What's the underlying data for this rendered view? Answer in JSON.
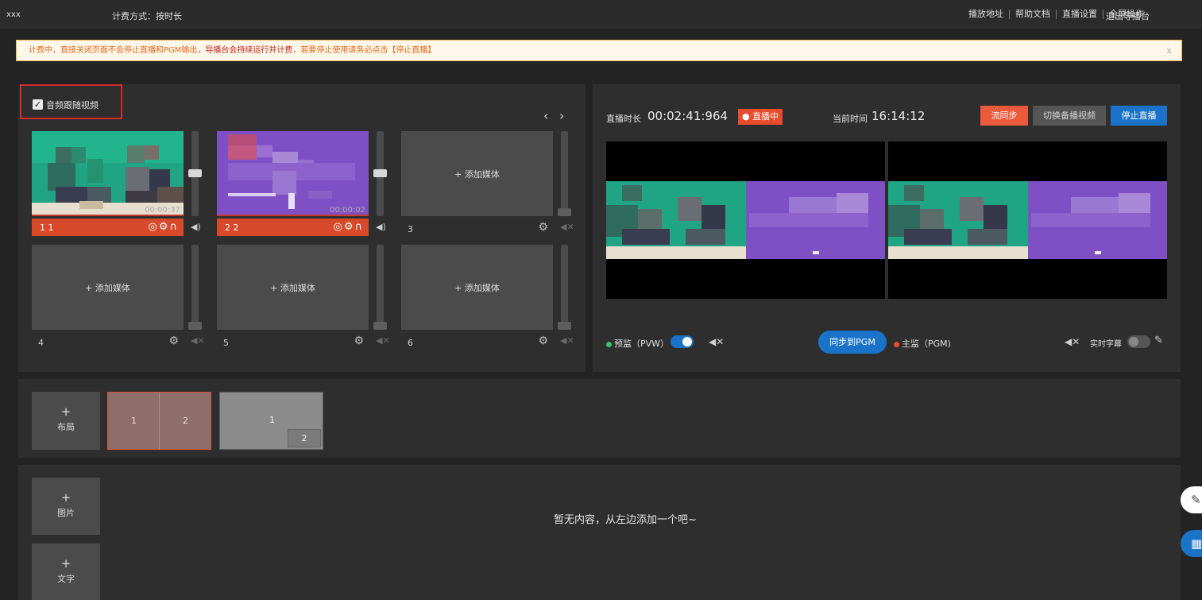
{
  "header": {
    "app_name": "xxx",
    "billing": "计费方式：按时长",
    "nav": [
      "播放地址",
      "帮助文档",
      "直播设置",
      "全屏操作"
    ],
    "exit": "退出导播台"
  },
  "notice": {
    "text_prefix": "计费中，直接关闭页面不会停止直播和PGM输出，",
    "text_warn": "导播台会持续运行并计费",
    "text_suffix": "，若要停止使用请务必点击【停止直播】",
    "close": "x"
  },
  "sources": {
    "audio_follow_label": "音频跟随视频",
    "audio_follow_checked": true,
    "prev_icon": "‹",
    "next_icon": "›",
    "tiles": [
      {
        "index": "1",
        "label": "1   1",
        "time": "00:00:37",
        "active": true,
        "volume": 0.5
      },
      {
        "index": "2",
        "label": "2   2",
        "time": "00:00:02",
        "active": true,
        "volume": 0.5
      },
      {
        "index": "3",
        "label": "3",
        "add_text": "+ 添加媒体",
        "volume": 0.0
      },
      {
        "index": "4",
        "label": "4",
        "add_text": "+ 添加媒体",
        "volume": 0.0
      },
      {
        "index": "5",
        "label": "5",
        "add_text": "+ 添加媒体",
        "volume": 0.0
      },
      {
        "index": "6",
        "label": "6",
        "add_text": "+ 添加媒体",
        "volume": 0.0
      }
    ]
  },
  "live": {
    "duration_label": "直播时长",
    "duration": "00:02:41:964",
    "status": "● 直播中",
    "current_time_label": "当前时间",
    "current_time": "16:14:12",
    "btn_stream_sync": "流同步",
    "btn_switch_backup": "切换备播视频",
    "btn_stop": "停止直播",
    "pvw_label": "预监（PVW）",
    "pgm_label": "主监（PGM)",
    "sync_to_pgm": "同步到PGM",
    "subtitle_label": "实时字幕",
    "pvw_toggle_on": true,
    "subtitle_toggle_on": false
  },
  "layouts": {
    "add_label": "布局",
    "add_plus": "+",
    "layout_a": [
      "1",
      "2"
    ],
    "layout_b": [
      "1",
      "2"
    ]
  },
  "overlays": {
    "image_label": "图片",
    "text_label": "文字",
    "plus": "+",
    "empty": "暂无内容，从左边添加一个吧~"
  },
  "colors": {
    "accent_blue": "#1a73c9",
    "live_red": "#e74c2c",
    "active_tile": "#d8492a",
    "pvw_dot": "#3cc36a",
    "pgm_dot": "#e74c2c"
  }
}
